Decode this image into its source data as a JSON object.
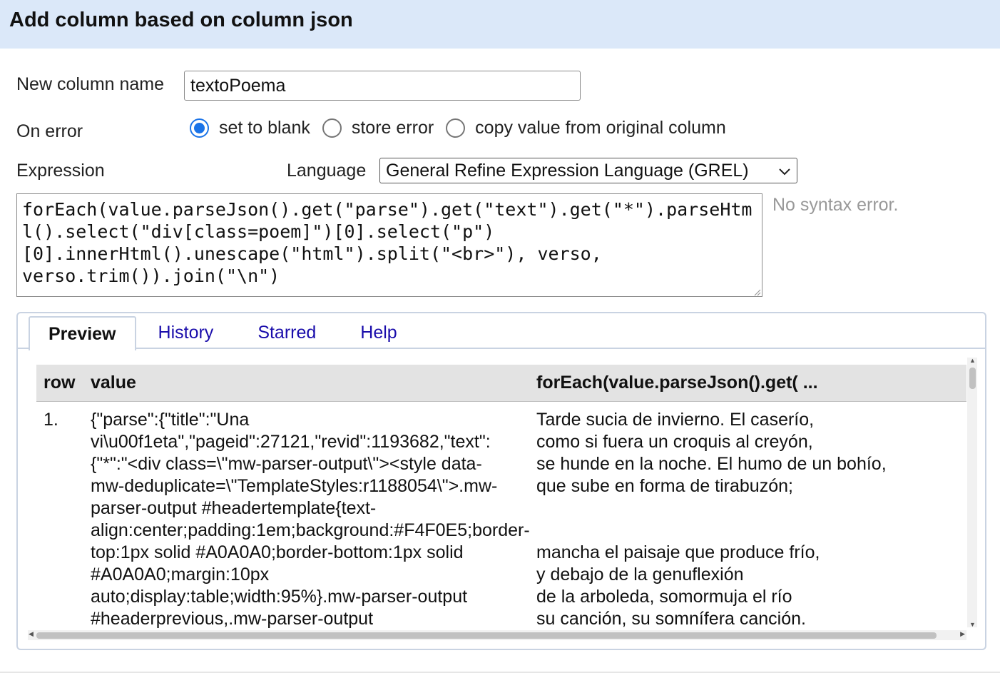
{
  "dialog": {
    "title": "Add column based on column json"
  },
  "new_column": {
    "label": "New column name",
    "value": "textoPoema"
  },
  "on_error": {
    "label": "On error",
    "options": [
      {
        "label": "set to blank",
        "checked": true
      },
      {
        "label": "store error",
        "checked": false
      },
      {
        "label": "copy value from original column",
        "checked": false
      }
    ]
  },
  "expression": {
    "label": "Expression",
    "language_label": "Language",
    "language_value": "General Refine Expression Language (GREL)",
    "text": "forEach(value.parseJson().get(\"parse\").get(\"text\").get(\"*\").parseHtml().select(\"div[class=poem]\")[0].select(\"p\")\n[0].innerHtml().unescape(\"html\").split(\"<br>\"), verso,\nverso.trim()).join(\"\\n\")",
    "status": "No syntax error."
  },
  "tabs": [
    {
      "label": "Preview",
      "active": true
    },
    {
      "label": "History",
      "active": false
    },
    {
      "label": "Starred",
      "active": false
    },
    {
      "label": "Help",
      "active": false
    }
  ],
  "preview": {
    "headers": {
      "row": "row",
      "value": "value",
      "result": "forEach(value.parseJson().get( ..."
    },
    "rows": [
      {
        "row": "1.",
        "value": "{\"parse\":{\"title\":\"Una\nvi\\u00f1eta\",\"pageid\":27121,\"revid\":1193682,\"text\":\n{\"*\":\"<div class=\\\"mw-parser-output\\\"><style data-\nmw-deduplicate=\\\"TemplateStyles:r1188054\\\">.mw-\nparser-output #headertemplate{text-\nalign:center;padding:1em;background:#F4F0E5;border-\ntop:1px solid #A0A0A0;border-bottom:1px solid\n#A0A0A0;margin:10px\nauto;display:table;width:95%}.mw-parser-output\n#headerprevious,.mw-parser-output",
        "result": "Tarde sucia de invierno. El caserío,\ncomo si fuera un croquis al creyón,\nse hunde en la noche. El humo de un bohío,\nque sube en forma de tirabuzón;\n\n\nmancha el paisaje que produce frío,\ny debajo de la genuflexión\nde la arboleda, somormuja el río\nsu canción, su somnífera canción."
      }
    ]
  }
}
